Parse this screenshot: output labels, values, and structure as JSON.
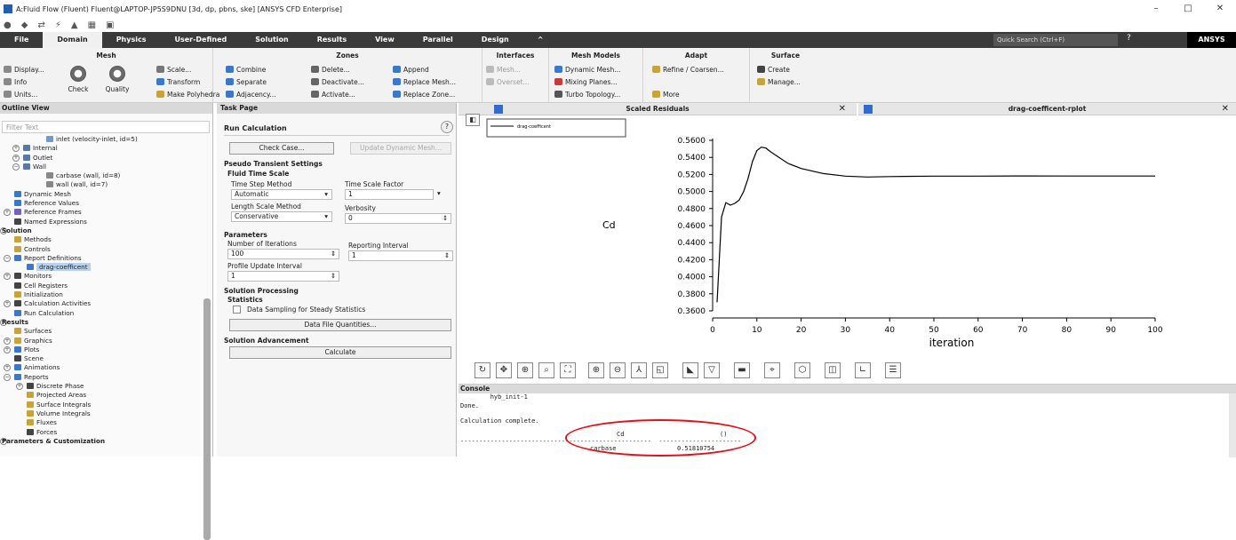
{
  "window": {
    "title": "A:Fluid Flow (Fluent) Fluent@LAPTOP-JP5S9DNU  [3d, dp, pbns, ske] [ANSYS CFD Enterprise]",
    "minimize": "–",
    "maximize": "□",
    "close": "✕"
  },
  "menu": {
    "items": [
      "File",
      "Domain",
      "Physics",
      "User-Defined",
      "Solution",
      "Results",
      "View",
      "Parallel",
      "Design",
      "^"
    ],
    "active": "Domain",
    "search_placeholder": "Quick Search (Ctrl+F)",
    "brand": "ANSYS"
  },
  "ribbon": {
    "mesh": {
      "title": "Mesh",
      "display": "Display...",
      "info": "Info",
      "units": "Units...",
      "check": "Check",
      "quality": "Quality",
      "scale": "Scale...",
      "transform": "Transform",
      "make_polyhedra": "Make Polyhedra"
    },
    "zones": {
      "title": "Zones",
      "combine": "Combine",
      "separate": "Separate",
      "adjacency": "Adjacency...",
      "delete": "Delete...",
      "deactivate": "Deactivate...",
      "activate": "Activate...",
      "append": "Append",
      "replace_mesh": "Replace Mesh...",
      "replace_zone": "Replace Zone..."
    },
    "interfaces": {
      "title": "Interfaces",
      "mesh": "Mesh...",
      "overset": "Overset..."
    },
    "mesh_models": {
      "title": "Mesh Models",
      "dynamic": "Dynamic Mesh...",
      "mixing": "Mixing Planes...",
      "turbo": "Turbo Topology..."
    },
    "adapt": {
      "title": "Adapt",
      "refine": "Refine / Coarsen...",
      "more": "More"
    },
    "surface": {
      "title": "Surface",
      "create": "Create",
      "manage": "Manage..."
    }
  },
  "outline": {
    "title": "Outline View",
    "filter_placeholder": "Filter Text",
    "items": [
      {
        "label": "inlet (velocity-inlet, id=5)",
        "indent": 52,
        "ic": "#6a9bd1"
      },
      {
        "label": "Internal",
        "indent": 26,
        "ex": "+",
        "ic": "#5577aa"
      },
      {
        "label": "Outlet",
        "indent": 26,
        "ex": "+",
        "ic": "#5577aa"
      },
      {
        "label": "Wall",
        "indent": 26,
        "ex": "−",
        "ic": "#5577aa"
      },
      {
        "label": "carbase (wall, id=8)",
        "indent": 52,
        "ic": "#888"
      },
      {
        "label": "wall (wall, id=7)",
        "indent": 52,
        "ic": "#888"
      },
      {
        "label": "Dynamic Mesh",
        "indent": 16,
        "ic": "#3a79c9"
      },
      {
        "label": "Reference Values",
        "indent": 16,
        "ic": "#3a79c9"
      },
      {
        "label": "Reference Frames",
        "indent": 16,
        "ex": "+",
        "ic": "#7a5cc9"
      },
      {
        "label": "Named Expressions",
        "indent": 16,
        "ic": "#444"
      },
      {
        "label": "Solution",
        "indent": 2,
        "ex": "−",
        "bold": true
      },
      {
        "label": "Methods",
        "indent": 16,
        "ic": "#c9a23a"
      },
      {
        "label": "Controls",
        "indent": 16,
        "ic": "#c9a23a"
      },
      {
        "label": "Report Definitions",
        "indent": 16,
        "ex": "−",
        "ic": "#3a79c9"
      },
      {
        "label": "drag-coefficent",
        "indent": 30,
        "ic": "#3a79c9",
        "sel": true
      },
      {
        "label": "Monitors",
        "indent": 16,
        "ex": "+",
        "ic": "#444"
      },
      {
        "label": "Cell Registers",
        "indent": 16,
        "ic": "#444"
      },
      {
        "label": "Initialization",
        "indent": 16,
        "ic": "#c9a23a"
      },
      {
        "label": "Calculation Activities",
        "indent": 16,
        "ex": "+",
        "ic": "#444"
      },
      {
        "label": "Run Calculation",
        "indent": 16,
        "ic": "#3a79c9"
      },
      {
        "label": "Results",
        "indent": 2,
        "ex": "−",
        "bold": true
      },
      {
        "label": "Surfaces",
        "indent": 16,
        "ic": "#c9a23a"
      },
      {
        "label": "Graphics",
        "indent": 16,
        "ex": "+",
        "ic": "#c9a23a"
      },
      {
        "label": "Plots",
        "indent": 16,
        "ex": "+",
        "ic": "#3a79c9"
      },
      {
        "label": "Scene",
        "indent": 16,
        "ic": "#444"
      },
      {
        "label": "Animations",
        "indent": 16,
        "ex": "+",
        "ic": "#3a79c9"
      },
      {
        "label": "Reports",
        "indent": 16,
        "ex": "−",
        "ic": "#3a79c9"
      },
      {
        "label": "Discrete Phase",
        "indent": 30,
        "ex": "+",
        "ic": "#444"
      },
      {
        "label": "Projected Areas",
        "indent": 30,
        "ic": "#c9a23a"
      },
      {
        "label": "Surface Integrals",
        "indent": 30,
        "ic": "#c9a23a"
      },
      {
        "label": "Volume Integrals",
        "indent": 30,
        "ic": "#c9a23a"
      },
      {
        "label": "Fluxes",
        "indent": 30,
        "ic": "#c9a23a"
      },
      {
        "label": "Forces",
        "indent": 30,
        "ic": "#444"
      },
      {
        "label": "Parameters & Customization",
        "indent": 2,
        "ex": "+",
        "bold": true
      }
    ]
  },
  "task": {
    "title": "Task Page",
    "heading": "Run Calculation",
    "help": "?",
    "check_case": "Check Case...",
    "update_dynamic": "Update Dynamic Mesh...",
    "pseudo": "Pseudo Transient Settings",
    "fluid_time_scale": "Fluid Time Scale",
    "ts_method_label": "Time Step Method",
    "ts_method_value": "Automatic",
    "ts_factor_label": "Time Scale Factor",
    "ts_factor_value": "1",
    "ls_method_label": "Length Scale Method",
    "ls_method_value": "Conservative",
    "verbosity_label": "Verbosity",
    "verbosity_value": "0",
    "parameters": "Parameters",
    "iter_label": "Number of Iterations",
    "iter_value": "100",
    "report_label": "Reporting Interval",
    "report_value": "1",
    "profile_label": "Profile Update Interval",
    "profile_value": "1",
    "processing": "Solution Processing",
    "statistics": "Statistics",
    "sampling": "Data Sampling for Steady Statistics",
    "data_file": "Data File Quantities...",
    "advancement": "Solution Advancement",
    "calculate": "Calculate"
  },
  "tabs": {
    "residuals": "Scaled Residuals",
    "rplot": "drag-coefficent-rplot",
    "close": "✕"
  },
  "chart_data": {
    "type": "line",
    "legend": [
      "drag-coefficent"
    ],
    "ylabel": "Cd",
    "xlabel": "iteration",
    "xlim": [
      0,
      100
    ],
    "ylim": [
      0.36,
      0.56
    ],
    "xticks": [
      "0",
      "10",
      "20",
      "30",
      "40",
      "50",
      "60",
      "70",
      "80",
      "90",
      "100"
    ],
    "yticks": [
      "0.3600",
      "0.3800",
      "0.4000",
      "0.4200",
      "0.4400",
      "0.4600",
      "0.4800",
      "0.5000",
      "0.5200",
      "0.5400",
      "0.5600"
    ],
    "series": [
      {
        "name": "drag-coefficent",
        "x": [
          1,
          2,
          3,
          4,
          5,
          6,
          7,
          8,
          9,
          10,
          11,
          12,
          13,
          15,
          17,
          20,
          25,
          30,
          35,
          40,
          50,
          60,
          70,
          80,
          90,
          100
        ],
        "y": [
          0.37,
          0.47,
          0.487,
          0.484,
          0.486,
          0.49,
          0.5,
          0.515,
          0.535,
          0.548,
          0.552,
          0.551,
          0.547,
          0.54,
          0.533,
          0.527,
          0.521,
          0.518,
          0.517,
          0.5175,
          0.518,
          0.518,
          0.5182,
          0.5181,
          0.5181,
          0.5181
        ]
      }
    ]
  },
  "console": {
    "title": "Console",
    "lines": [
      "        hyb_init-1",
      "Done.",
      "",
      "Calculation complete."
    ],
    "table_header": {
      "name": "Cd",
      "unit": "()"
    },
    "rule": "---------------------------------------------------  ----------------------",
    "row": {
      "name": "carbase",
      "value": "0.51810754"
    }
  }
}
